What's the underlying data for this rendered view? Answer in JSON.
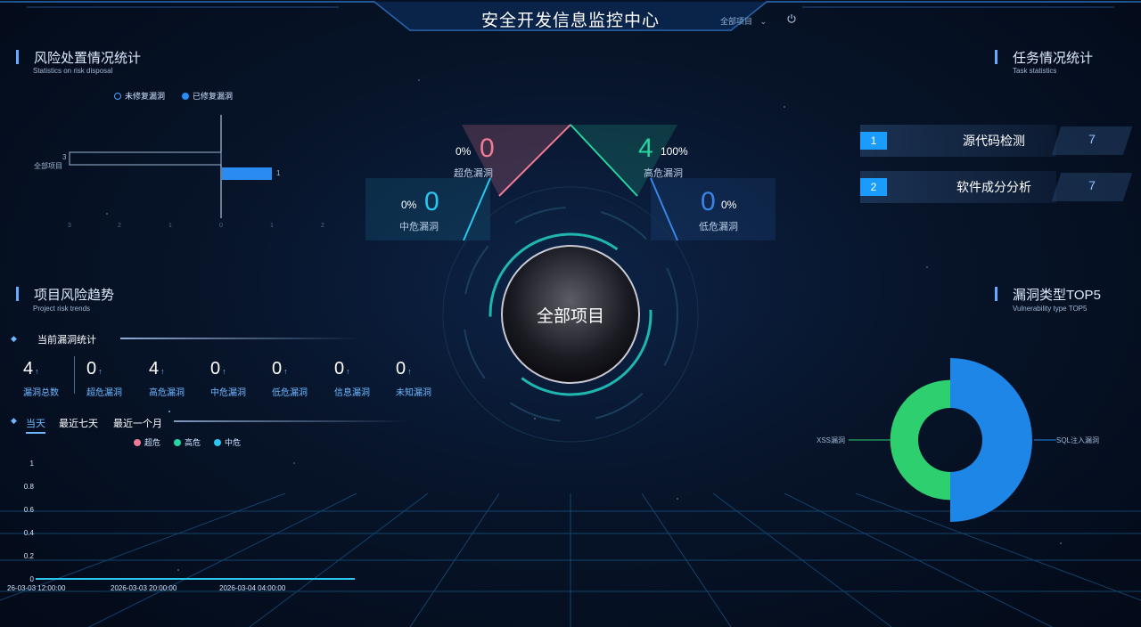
{
  "header": {
    "title": "安全开发信息监控中心",
    "project_select": "全部项目"
  },
  "risk_disposal": {
    "title": "风险处置情况统计",
    "subtitle": "Statistics on risk disposal",
    "legend": [
      "未修复漏洞",
      "已修复漏洞"
    ],
    "category": "全部项目",
    "unfixed_value": "3",
    "fixed_value": "1",
    "axis_ticks": [
      "3",
      "2",
      "1",
      "0",
      "1",
      "2"
    ]
  },
  "project_risk": {
    "title": "项目风险趋势",
    "subtitle": "Project risk trends",
    "current_label": "当前漏洞统计",
    "stats": [
      {
        "value": "4",
        "label": "漏洞总数"
      },
      {
        "value": "0",
        "label": "超危漏洞"
      },
      {
        "value": "4",
        "label": "高危漏洞"
      },
      {
        "value": "0",
        "label": "中危漏洞"
      },
      {
        "value": "0",
        "label": "低危漏洞"
      },
      {
        "value": "0",
        "label": "信息漏洞"
      },
      {
        "value": "0",
        "label": "未知漏洞"
      }
    ],
    "tabs": [
      "当天",
      "最近七天",
      "最近一个月"
    ],
    "legend": [
      "超危",
      "高危",
      "中危"
    ],
    "legend_colors": [
      "#f07a93",
      "#26d6a0",
      "#2bc6ee"
    ]
  },
  "chart_data": [
    {
      "type": "bar",
      "categories": [
        "全部项目"
      ],
      "series": [
        {
          "name": "未修复漏洞",
          "values": [
            3
          ]
        },
        {
          "name": "已修复漏洞",
          "values": [
            1
          ]
        }
      ],
      "ylim": [
        -3,
        2
      ]
    },
    {
      "type": "line",
      "x": [
        "26-03-03 12:00:00",
        "2026-03-03 20:00:00",
        "2026-03-04 04:00:00"
      ],
      "y_ticks": [
        "1",
        "0.8",
        "0.6",
        "0.4",
        "0.2",
        "0"
      ],
      "series": [
        {
          "name": "超危",
          "values": [
            0,
            0,
            0
          ]
        },
        {
          "name": "高危",
          "values": [
            0,
            0,
            0
          ]
        },
        {
          "name": "中危",
          "values": [
            0,
            0,
            0
          ]
        }
      ],
      "ylim": [
        0,
        1
      ]
    },
    {
      "type": "pie",
      "labels": [
        "XSS漏洞",
        "SQL注入漏洞"
      ],
      "values": [
        1,
        3
      ],
      "colors": [
        "#2dcf6f",
        "#1e86e6"
      ]
    }
  ],
  "center": {
    "label": "全部项目",
    "critical": {
      "pct": "0%",
      "value": "0",
      "label": "超危漏洞",
      "color": "#f07a93"
    },
    "high": {
      "pct": "100%",
      "value": "4",
      "label": "高危漏洞",
      "color": "#26d6a0"
    },
    "medium": {
      "pct": "0%",
      "value": "0",
      "label": "中危漏洞",
      "color": "#2bc6ee"
    },
    "low": {
      "pct": "0%",
      "value": "0",
      "label": "低危漏洞",
      "color": "#3a84e6"
    }
  },
  "tasks": {
    "title": "任务情况统计",
    "subtitle": "Task statistics",
    "rows": [
      {
        "index": "1",
        "name": "源代码检测",
        "count": "7"
      },
      {
        "index": "2",
        "name": "软件成分分析",
        "count": "7"
      }
    ]
  },
  "top5": {
    "title": "漏洞类型TOP5",
    "subtitle": "Vulnerability type TOP5"
  }
}
